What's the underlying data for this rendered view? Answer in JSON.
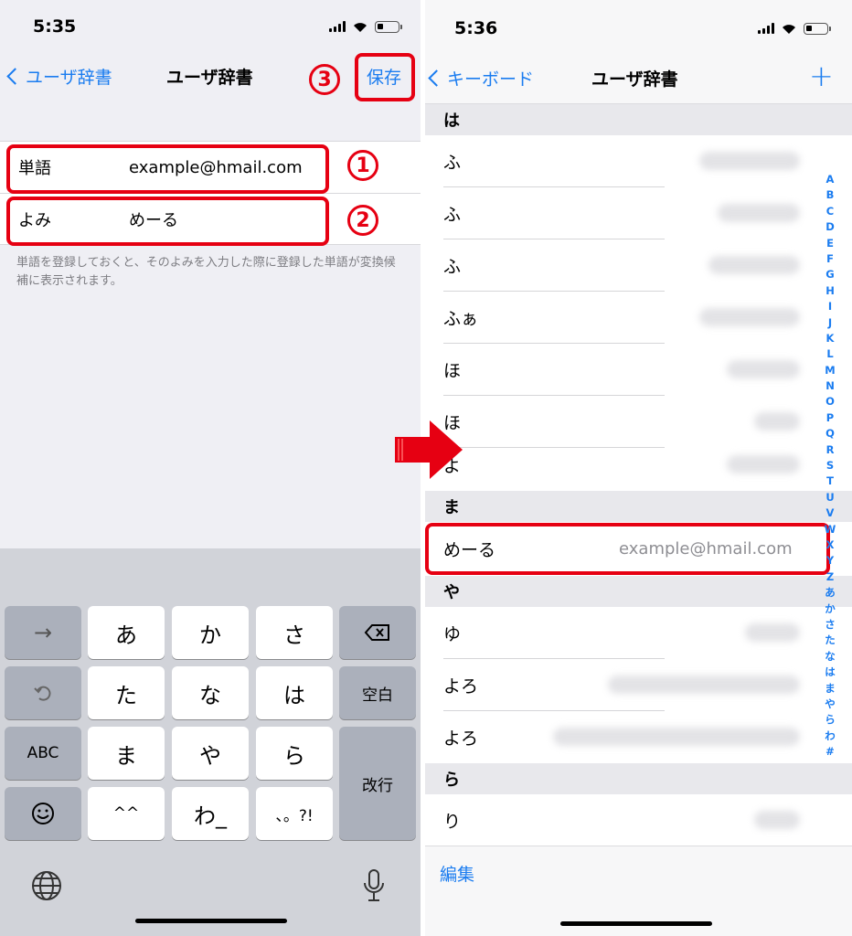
{
  "left": {
    "status_time": "5:35",
    "back_label": "ユーザ辞書",
    "title": "ユーザ辞書",
    "save_label": "保存",
    "step3": "③",
    "form": {
      "word_label": "単語",
      "word_value": "example@hmail.com",
      "reading_label": "よみ",
      "reading_value": "めーる"
    },
    "step1": "①",
    "step2": "②",
    "hint": "単語を登録しておくと、そのよみを入力した際に登録した単語が変換候補に表示されます。",
    "keyboard": {
      "row1": [
        "→",
        "あ",
        "か",
        "さ",
        "⌫"
      ],
      "row2": [
        "↶",
        "た",
        "な",
        "は",
        "空白"
      ],
      "row3": [
        "ABC",
        "ま",
        "や",
        "ら"
      ],
      "row4": [
        "☺",
        "^^",
        "わ_",
        "、。?!"
      ],
      "return_label": "改行",
      "globe_icon": "globe-icon",
      "mic_icon": "microphone-icon"
    }
  },
  "right": {
    "status_time": "5:36",
    "back_label": "キーボード",
    "title": "ユーザ辞書",
    "add_label": "+",
    "sections": [
      {
        "head": "は",
        "rows": [
          "ふ",
          "ふ",
          "ふ",
          "ふぁ",
          "ほ",
          "ほ",
          "よ"
        ]
      },
      {
        "head": "ま",
        "rows": [
          "めーる"
        ]
      },
      {
        "head": "や",
        "rows": [
          "ゆ",
          "よろ",
          "よろ"
        ]
      },
      {
        "head": "ら",
        "rows": [
          "り"
        ]
      }
    ],
    "highlight_value": "example@hmail.com",
    "index": [
      "A",
      "B",
      "C",
      "D",
      "E",
      "F",
      "G",
      "H",
      "I",
      "J",
      "K",
      "L",
      "M",
      "N",
      "O",
      "P",
      "Q",
      "R",
      "S",
      "T",
      "U",
      "V",
      "W",
      "X",
      "Y",
      "Z",
      "あ",
      "か",
      "さ",
      "た",
      "な",
      "は",
      "ま",
      "や",
      "ら",
      "わ",
      "#"
    ],
    "edit_label": "編集"
  },
  "colors": {
    "accent": "#1a7cf0",
    "annotation_red": "#e60012"
  }
}
